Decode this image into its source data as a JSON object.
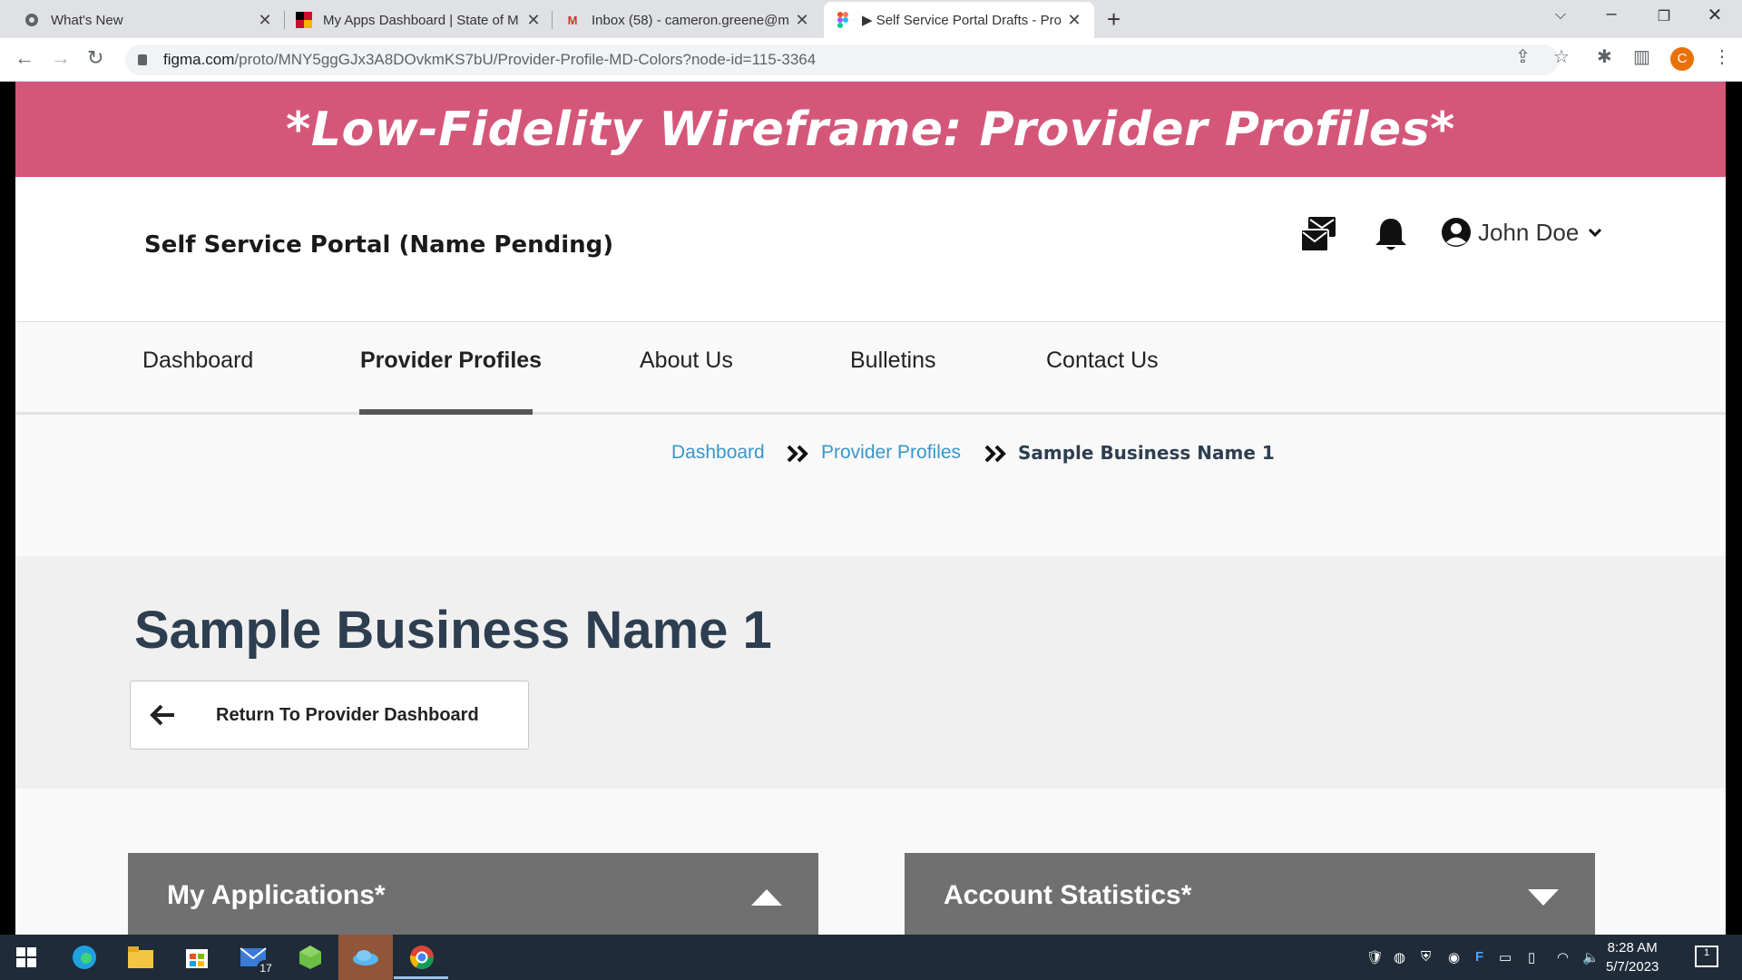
{
  "browser": {
    "tabs": [
      {
        "title": "What's New",
        "icon": "chrome-icon"
      },
      {
        "title": "My Apps Dashboard | State of M",
        "icon": "state-flag-icon"
      },
      {
        "title": "Inbox (58) - cameron.greene@m",
        "icon": "gmail-icon"
      },
      {
        "title": "▶ Self Service Portal Drafts - Pro",
        "icon": "figma-icon"
      }
    ],
    "url_host": "figma.com",
    "url_path": "/proto/MNY5ggGJx3A8DOvkmKS7bU/Provider-Profile-MD-Colors?node-id=115-3364",
    "profile_initial": "C"
  },
  "banner": {
    "text": "*Low-Fidelity Wireframe: Provider Profiles*",
    "color": "#d4577a"
  },
  "header": {
    "portal_title": "Self Service Portal (Name Pending)",
    "user_name": "John Doe"
  },
  "nav": {
    "items": [
      "Dashboard",
      "Provider Profiles",
      "About Us",
      "Bulletins",
      "Contact Us"
    ],
    "active_index": 1
  },
  "breadcrumb": {
    "items": [
      "Dashboard",
      "Provider Profiles"
    ],
    "current": "Sample Business Name 1",
    "link_color": "#3a96c8"
  },
  "hero": {
    "title": "Sample Business Name 1",
    "return_button": "Return To Provider Dashboard"
  },
  "panels": [
    {
      "title": "My Applications*",
      "state": "expanded"
    },
    {
      "title": "Account Statistics*",
      "state": "collapsed"
    }
  ],
  "taskbar": {
    "mail_badge": "17",
    "time": "8:28 AM",
    "date": "5/7/2023",
    "notifications": "1"
  }
}
